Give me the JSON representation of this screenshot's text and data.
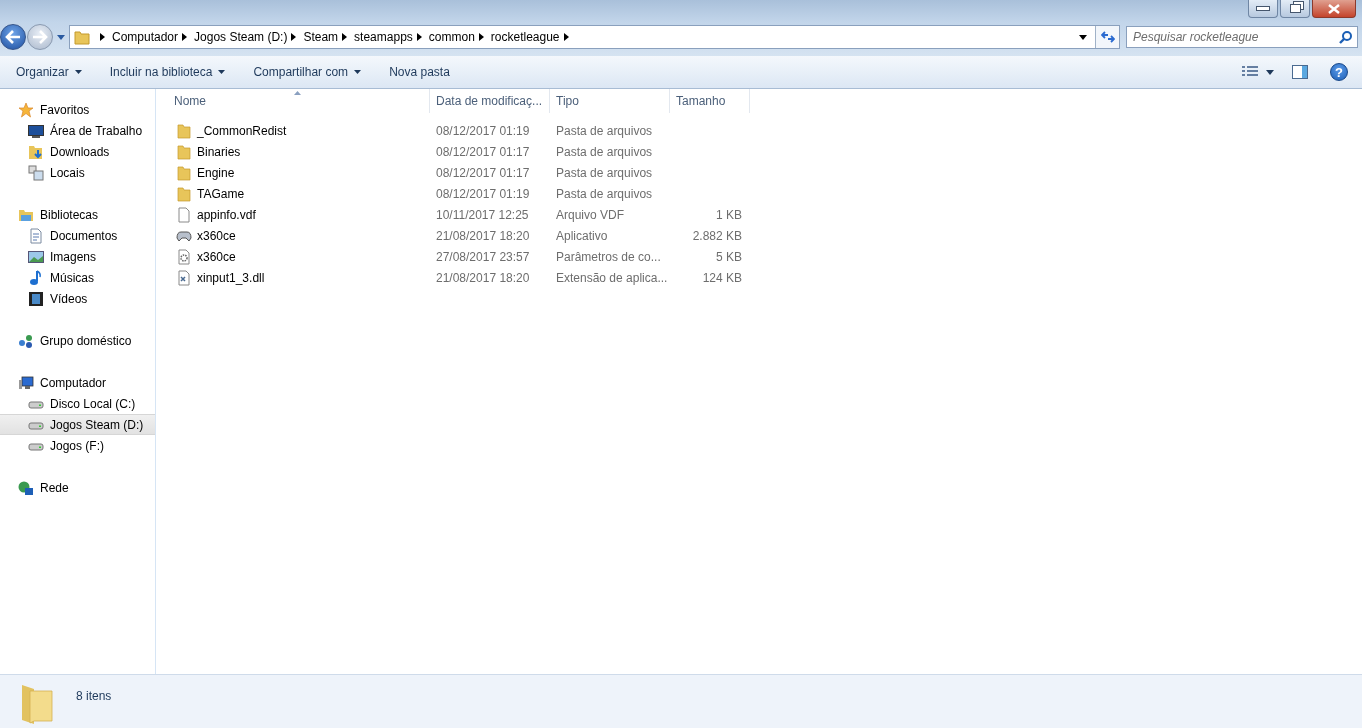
{
  "address_bar": {
    "breadcrumbs": [
      "Computador",
      "Jogos Steam (D:)",
      "Steam",
      "steamapps",
      "common",
      "rocketleague"
    ]
  },
  "search": {
    "placeholder": "Pesquisar rocketleague"
  },
  "toolbar": {
    "buttons": [
      {
        "label": "Organizar",
        "dropdown": true
      },
      {
        "label": "Incluir na biblioteca",
        "dropdown": true
      },
      {
        "label": "Compartilhar com",
        "dropdown": true
      },
      {
        "label": "Nova pasta",
        "dropdown": false
      }
    ],
    "help_button": "?"
  },
  "sidebar": {
    "groups": [
      {
        "label": "Favoritos",
        "kind": "star",
        "selected": false,
        "children": [
          {
            "label": "Área de Trabalho",
            "kind": "desktop",
            "selected": false
          },
          {
            "label": "Downloads",
            "kind": "downloads",
            "selected": false
          },
          {
            "label": "Locais",
            "kind": "recent",
            "selected": false
          }
        ]
      },
      {
        "label": "Bibliotecas",
        "kind": "library",
        "selected": false,
        "children": [
          {
            "label": "Documentos",
            "kind": "document",
            "selected": false
          },
          {
            "label": "Imagens",
            "kind": "pictures",
            "selected": false
          },
          {
            "label": "Músicas",
            "kind": "music",
            "selected": false
          },
          {
            "label": "Vídeos",
            "kind": "videos",
            "selected": false
          }
        ]
      },
      {
        "label": "Grupo doméstico",
        "kind": "homegroup",
        "selected": false
      },
      {
        "label": "Computador",
        "kind": "computer",
        "selected": false,
        "children": [
          {
            "label": "Disco Local (C:)",
            "kind": "drive",
            "selected": false
          },
          {
            "label": "Jogos Steam (D:)",
            "kind": "drive",
            "selected": true
          },
          {
            "label": "Jogos (F:)",
            "kind": "drive",
            "selected": false
          }
        ]
      },
      {
        "label": "Rede",
        "kind": "network",
        "selected": false
      }
    ]
  },
  "table": {
    "columns": [
      "Nome",
      "Data de modificaç...",
      "Tipo",
      "Tamanho"
    ],
    "rows": [
      {
        "name": "_CommonRedist",
        "date": "08/12/2017 01:19",
        "type": "Pasta de arquivos",
        "kind": "folder"
      },
      {
        "name": "Binaries",
        "date": "08/12/2017 01:17",
        "type": "Pasta de arquivos",
        "kind": "folder"
      },
      {
        "name": "Engine",
        "date": "08/12/2017 01:17",
        "type": "Pasta de arquivos",
        "kind": "folder"
      },
      {
        "name": "TAGame",
        "date": "08/12/2017 01:19",
        "type": "Pasta de arquivos",
        "kind": "folder"
      },
      {
        "name": "appinfo.vdf",
        "date": "10/11/2017 12:25",
        "type": "Arquivo VDF",
        "size": "1 KB",
        "kind": "file"
      },
      {
        "name": "x360ce",
        "date": "21/08/2017 18:20",
        "type": "Aplicativo",
        "size": "2.882 KB",
        "kind": "app"
      },
      {
        "name": "x360ce",
        "date": "27/08/2017 23:57",
        "type": "Parâmetros de co...",
        "size": "5 KB",
        "kind": "config"
      },
      {
        "name": "xinput1_3.dll",
        "date": "21/08/2017 18:20",
        "type": "Extensão de aplica...",
        "size": "124 KB",
        "kind": "dll"
      }
    ]
  },
  "status_bar": {
    "count": "8 itens"
  }
}
